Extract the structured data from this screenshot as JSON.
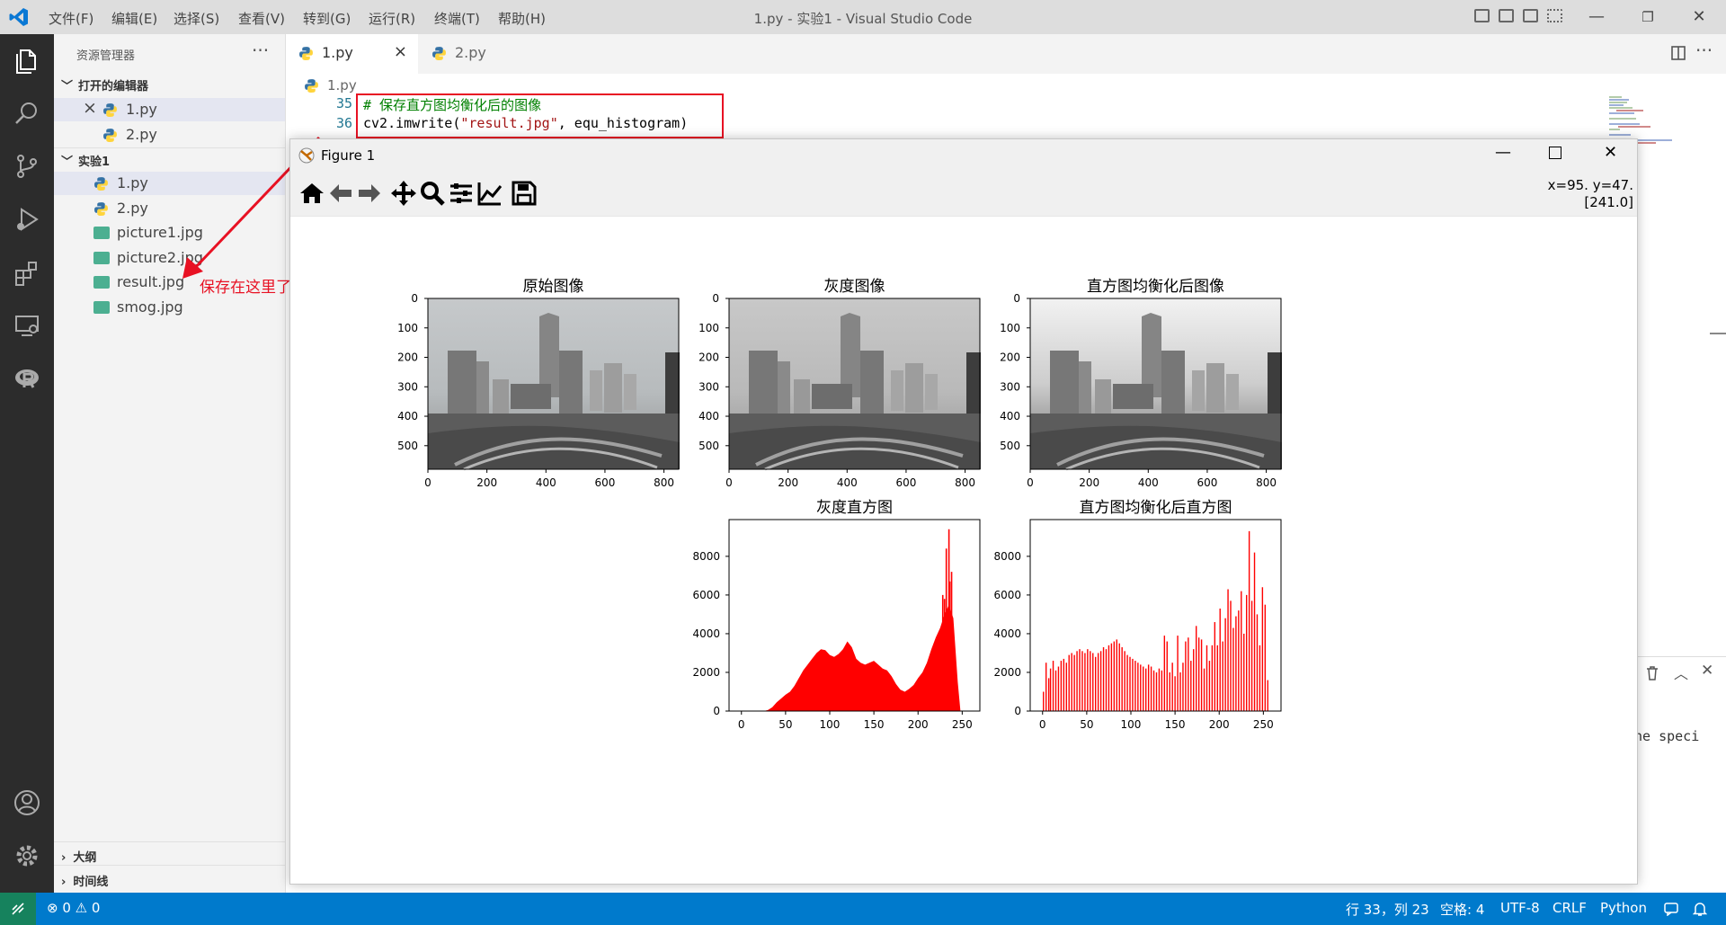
{
  "titlebar": {
    "menus": [
      "文件(F)",
      "编辑(E)",
      "选择(S)",
      "查看(V)",
      "转到(G)",
      "运行(R)",
      "终端(T)",
      "帮助(H)"
    ],
    "window_title": "1.py - 实验1 - Visual Studio Code"
  },
  "activity_bar": {
    "icons": [
      "files-icon",
      "search-icon",
      "source-control-icon",
      "run-debug-icon",
      "extensions-icon",
      "remote-explorer-icon",
      "r-icon",
      "account-icon",
      "settings-gear-icon"
    ]
  },
  "sidebar": {
    "title": "资源管理器",
    "open_editors_label": "打开的编辑器",
    "open_editors": [
      {
        "name": "1.py",
        "close": "×"
      },
      {
        "name": "2.py"
      }
    ],
    "folder_label": "实验1",
    "files": [
      {
        "name": "1.py",
        "type": "py"
      },
      {
        "name": "2.py",
        "type": "py"
      },
      {
        "name": "picture1.jpg",
        "type": "img"
      },
      {
        "name": "picture2.jpg",
        "type": "img"
      },
      {
        "name": "result.jpg",
        "type": "img"
      },
      {
        "name": "smog.jpg",
        "type": "img"
      }
    ],
    "outline_label": "大纲",
    "timeline_label": "时间线",
    "annotation": "保存在这里了"
  },
  "tabs": [
    {
      "label": "1.py",
      "active": true,
      "close": "×"
    },
    {
      "label": "2.py",
      "active": false
    }
  ],
  "breadcrumb": "1.py",
  "editor": {
    "lines": [
      {
        "no": "35",
        "text": "# 保存直方图均衡化后的图像"
      },
      {
        "no": "36",
        "text_parts": [
          "cv2.imwrite(",
          "\"result.jpg\"",
          ", equ_histogram)"
        ]
      }
    ],
    "panel_text": "ne speci"
  },
  "figure": {
    "title": "Figure 1",
    "coord_line1": "x=95. y=47.",
    "coord_line2": "[241.0]",
    "toolbar": [
      "home-icon",
      "back-arrow-icon",
      "forward-arrow-icon",
      "pan-icon",
      "zoom-icon",
      "configure-subplots-icon",
      "edit-axis-icon",
      "save-icon"
    ]
  },
  "chart_data": [
    {
      "type": "image",
      "title": "原始图像",
      "xticks": [
        0,
        200,
        400,
        600,
        800
      ],
      "yticks": [
        0,
        100,
        200,
        300,
        400,
        500
      ],
      "xlim": [
        0,
        850
      ],
      "ylim": [
        580,
        0
      ]
    },
    {
      "type": "image",
      "title": "灰度图像",
      "xticks": [
        0,
        200,
        400,
        600,
        800
      ],
      "yticks": [
        0,
        100,
        200,
        300,
        400,
        500
      ],
      "xlim": [
        0,
        850
      ],
      "ylim": [
        580,
        0
      ]
    },
    {
      "type": "image",
      "title": "直方图均衡化后图像",
      "xticks": [
        0,
        200,
        400,
        600,
        800
      ],
      "yticks": [
        0,
        100,
        200,
        300,
        400,
        500
      ],
      "xlim": [
        0,
        850
      ],
      "ylim": [
        580,
        0
      ]
    },
    {
      "type": "bar",
      "title": "灰度直方图",
      "color": "#ff0000",
      "xticks": [
        0,
        50,
        100,
        150,
        200,
        250
      ],
      "yticks": [
        0,
        2000,
        4000,
        6000,
        8000
      ],
      "xlim": [
        -14,
        270
      ],
      "ylim": [
        0,
        9900
      ],
      "envelope": [
        [
          25,
          0
        ],
        [
          30,
          50
        ],
        [
          35,
          200
        ],
        [
          40,
          450
        ],
        [
          45,
          650
        ],
        [
          50,
          850
        ],
        [
          55,
          1000
        ],
        [
          60,
          1300
        ],
        [
          65,
          1700
        ],
        [
          70,
          2100
        ],
        [
          75,
          2400
        ],
        [
          80,
          2700
        ],
        [
          85,
          3000
        ],
        [
          90,
          3200
        ],
        [
          95,
          3150
        ],
        [
          100,
          2900
        ],
        [
          105,
          2800
        ],
        [
          110,
          2950
        ],
        [
          115,
          3200
        ],
        [
          120,
          3600
        ],
        [
          125,
          3300
        ],
        [
          130,
          2700
        ],
        [
          135,
          2500
        ],
        [
          140,
          2400
        ],
        [
          145,
          2500
        ],
        [
          150,
          2600
        ],
        [
          155,
          2400
        ],
        [
          160,
          2200
        ],
        [
          165,
          2100
        ],
        [
          170,
          1800
        ],
        [
          175,
          1400
        ],
        [
          180,
          1100
        ],
        [
          185,
          1000
        ],
        [
          190,
          1150
        ],
        [
          195,
          1350
        ],
        [
          200,
          1700
        ],
        [
          205,
          2000
        ],
        [
          210,
          2500
        ],
        [
          215,
          3200
        ],
        [
          220,
          3800
        ],
        [
          225,
          4300
        ],
        [
          230,
          5000
        ],
        [
          235,
          5500
        ],
        [
          240,
          4800
        ],
        [
          245,
          1500
        ],
        [
          248,
          0
        ]
      ],
      "spikes": [
        [
          232,
          8400
        ],
        [
          235,
          9400
        ],
        [
          238,
          7200
        ],
        [
          236,
          6700
        ],
        [
          230,
          5800
        ],
        [
          228,
          6000
        ]
      ]
    },
    {
      "type": "bar",
      "title": "直方图均衡化后直方图",
      "color": "#ff0000",
      "xticks": [
        0,
        50,
        100,
        150,
        200,
        250
      ],
      "yticks": [
        0,
        2000,
        4000,
        6000,
        8000
      ],
      "xlim": [
        -14,
        270
      ],
      "ylim": [
        0,
        9900
      ],
      "bars": [
        [
          1,
          1000
        ],
        [
          4,
          2500
        ],
        [
          7,
          1700
        ],
        [
          9,
          2200
        ],
        [
          12,
          2600
        ],
        [
          15,
          2100
        ],
        [
          18,
          2300
        ],
        [
          21,
          2600
        ],
        [
          24,
          2700
        ],
        [
          27,
          2500
        ],
        [
          30,
          2900
        ],
        [
          33,
          3000
        ],
        [
          36,
          2900
        ],
        [
          39,
          3100
        ],
        [
          42,
          3200
        ],
        [
          45,
          3100
        ],
        [
          48,
          3000
        ],
        [
          51,
          3200
        ],
        [
          54,
          3100
        ],
        [
          57,
          3000
        ],
        [
          60,
          2800
        ],
        [
          63,
          3000
        ],
        [
          66,
          3100
        ],
        [
          69,
          3300
        ],
        [
          72,
          3200
        ],
        [
          75,
          3400
        ],
        [
          78,
          3500
        ],
        [
          81,
          3600
        ],
        [
          84,
          3700
        ],
        [
          87,
          3500
        ],
        [
          90,
          3300
        ],
        [
          93,
          3100
        ],
        [
          96,
          2900
        ],
        [
          99,
          2800
        ],
        [
          102,
          2700
        ],
        [
          105,
          2600
        ],
        [
          108,
          2500
        ],
        [
          111,
          2400
        ],
        [
          114,
          2300
        ],
        [
          117,
          2200
        ],
        [
          120,
          2400
        ],
        [
          123,
          2300
        ],
        [
          126,
          2100
        ],
        [
          129,
          2000
        ],
        [
          132,
          2200
        ],
        [
          135,
          2100
        ],
        [
          138,
          3900
        ],
        [
          141,
          3600
        ],
        [
          144,
          2000
        ],
        [
          147,
          2500
        ],
        [
          150,
          1800
        ],
        [
          153,
          3900
        ],
        [
          156,
          2000
        ],
        [
          159,
          2500
        ],
        [
          162,
          3600
        ],
        [
          165,
          3800
        ],
        [
          168,
          2600
        ],
        [
          171,
          3200
        ],
        [
          174,
          4400
        ],
        [
          177,
          3800
        ],
        [
          180,
          3700
        ],
        [
          183,
          2200
        ],
        [
          186,
          3400
        ],
        [
          189,
          2600
        ],
        [
          192,
          3400
        ],
        [
          195,
          4600
        ],
        [
          198,
          3400
        ],
        [
          201,
          5300
        ],
        [
          204,
          3600
        ],
        [
          207,
          4800
        ],
        [
          210,
          6300
        ],
        [
          213,
          5700
        ],
        [
          216,
          4300
        ],
        [
          219,
          4900
        ],
        [
          222,
          5200
        ],
        [
          225,
          6200
        ],
        [
          228,
          4000
        ],
        [
          231,
          6000
        ],
        [
          234,
          9300
        ],
        [
          237,
          5700
        ],
        [
          240,
          8200
        ],
        [
          243,
          5000
        ],
        [
          246,
          3400
        ],
        [
          249,
          6400
        ],
        [
          252,
          5500
        ],
        [
          255,
          1600
        ]
      ]
    }
  ]
}
